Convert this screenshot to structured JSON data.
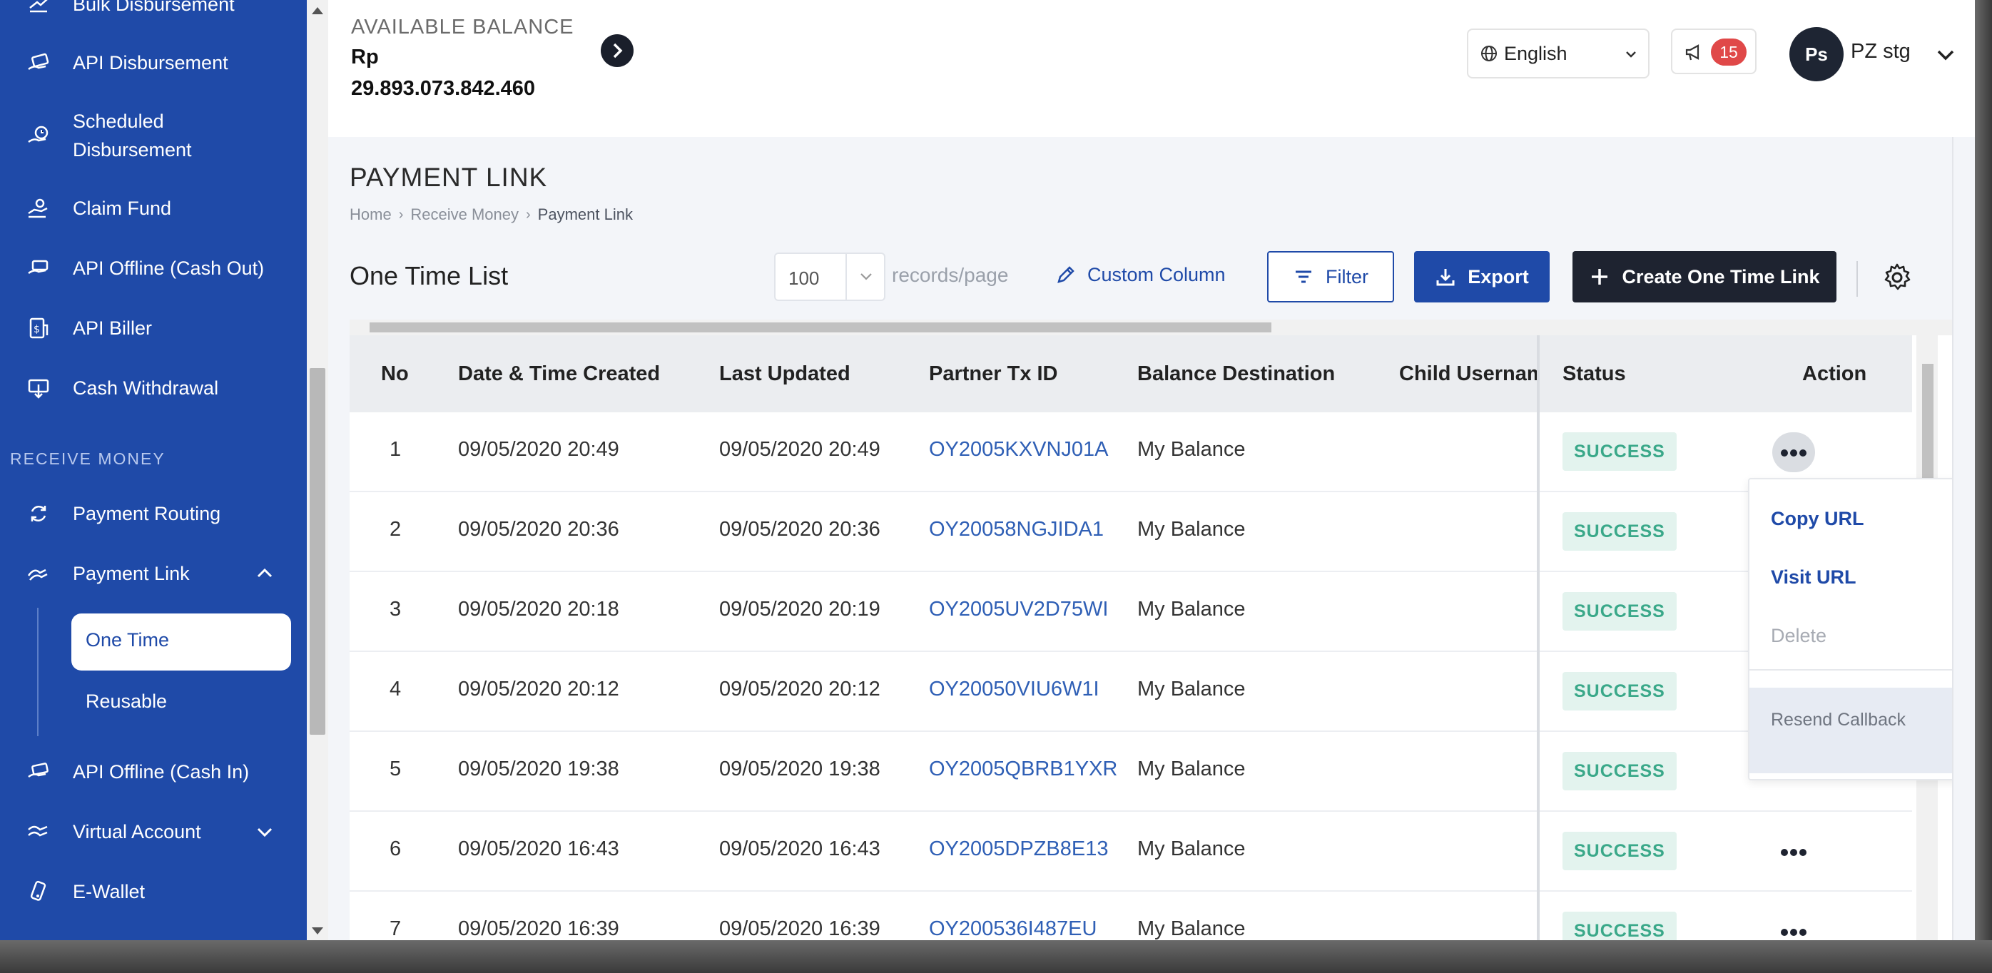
{
  "sidebar": {
    "items": [
      {
        "label": "Bulk Disbursement",
        "icon": "bulk-disbursement-icon"
      },
      {
        "label": "API Disbursement",
        "icon": "api-disbursement-icon"
      },
      {
        "label": "Scheduled",
        "label2": "Disbursement",
        "icon": "scheduled-disbursement-icon"
      },
      {
        "label": "Claim Fund",
        "icon": "claim-fund-icon"
      },
      {
        "label": "API Offline (Cash Out)",
        "icon": "cash-out-icon"
      },
      {
        "label": "API Biller",
        "icon": "biller-icon"
      },
      {
        "label": "Cash Withdrawal",
        "icon": "cash-withdrawal-icon"
      }
    ],
    "section_receive": "RECEIVE MONEY",
    "receive_items": [
      {
        "label": "Payment Routing",
        "icon": "payment-routing-icon"
      },
      {
        "label": "Payment Link",
        "icon": "payment-link-icon"
      },
      {
        "label": "API Offline (Cash In)",
        "icon": "cash-in-icon"
      },
      {
        "label": "Virtual Account",
        "icon": "virtual-account-icon"
      },
      {
        "label": "E-Wallet",
        "icon": "e-wallet-icon"
      }
    ],
    "sub_items": [
      "One Time",
      "Reusable"
    ]
  },
  "header": {
    "balance_label": "AVAILABLE BALANCE",
    "balance_currency": "Rp",
    "balance_value": "29.893.073.842.460",
    "language": "English",
    "notification_count": "15",
    "avatar_initials": "Ps",
    "username": "PZ stg"
  },
  "page": {
    "title": "PAYMENT LINK",
    "breadcrumb": [
      "Home",
      "Receive Money",
      "Payment Link"
    ],
    "list_title": "One Time List",
    "per_page_value": "100",
    "per_page_label": "records/page",
    "custom_column": "Custom Column",
    "filter": "Filter",
    "export": "Export",
    "create": "Create One Time Link"
  },
  "table": {
    "columns": [
      "No",
      "Date & Time Created",
      "Last Updated",
      "Partner Tx ID",
      "Balance Destination",
      "Child Usernam",
      "Status",
      "Action"
    ],
    "rows": [
      {
        "no": "1",
        "created": "09/05/2020 20:49",
        "updated": "09/05/2020 20:49",
        "tx": "OY2005KXVNJ01A",
        "dest": "My Balance",
        "status": "SUCCESS"
      },
      {
        "no": "2",
        "created": "09/05/2020 20:36",
        "updated": "09/05/2020 20:36",
        "tx": "OY20058NGJIDA1",
        "dest": "My Balance",
        "status": "SUCCESS"
      },
      {
        "no": "3",
        "created": "09/05/2020 20:18",
        "updated": "09/05/2020 20:19",
        "tx": "OY2005UV2D75WI",
        "dest": "My Balance",
        "status": "SUCCESS"
      },
      {
        "no": "4",
        "created": "09/05/2020 20:12",
        "updated": "09/05/2020 20:12",
        "tx": "OY20050VIU6W1I",
        "dest": "My Balance",
        "status": "SUCCESS"
      },
      {
        "no": "5",
        "created": "09/05/2020 19:38",
        "updated": "09/05/2020 19:38",
        "tx": "OY2005QBRB1YXR",
        "dest": "My Balance",
        "status": "SUCCESS"
      },
      {
        "no": "6",
        "created": "09/05/2020 16:43",
        "updated": "09/05/2020 16:43",
        "tx": "OY2005DPZB8E13",
        "dest": "My Balance",
        "status": "SUCCESS"
      },
      {
        "no": "7",
        "created": "09/05/2020 16:39",
        "updated": "09/05/2020 16:39",
        "tx": "OY200536I487EU",
        "dest": "My Balance",
        "status": "SUCCESS"
      }
    ]
  },
  "action_menu": {
    "copy": "Copy URL",
    "visit": "Visit URL",
    "delete": "Delete",
    "resend": "Resend Callback"
  },
  "colors": {
    "sidebar": "#1f4aa8",
    "primary": "#1f4aa8",
    "dark": "#1e2330",
    "success_text": "#3aa889",
    "success_bg": "#e3f3ee",
    "badge": "#e04848"
  }
}
